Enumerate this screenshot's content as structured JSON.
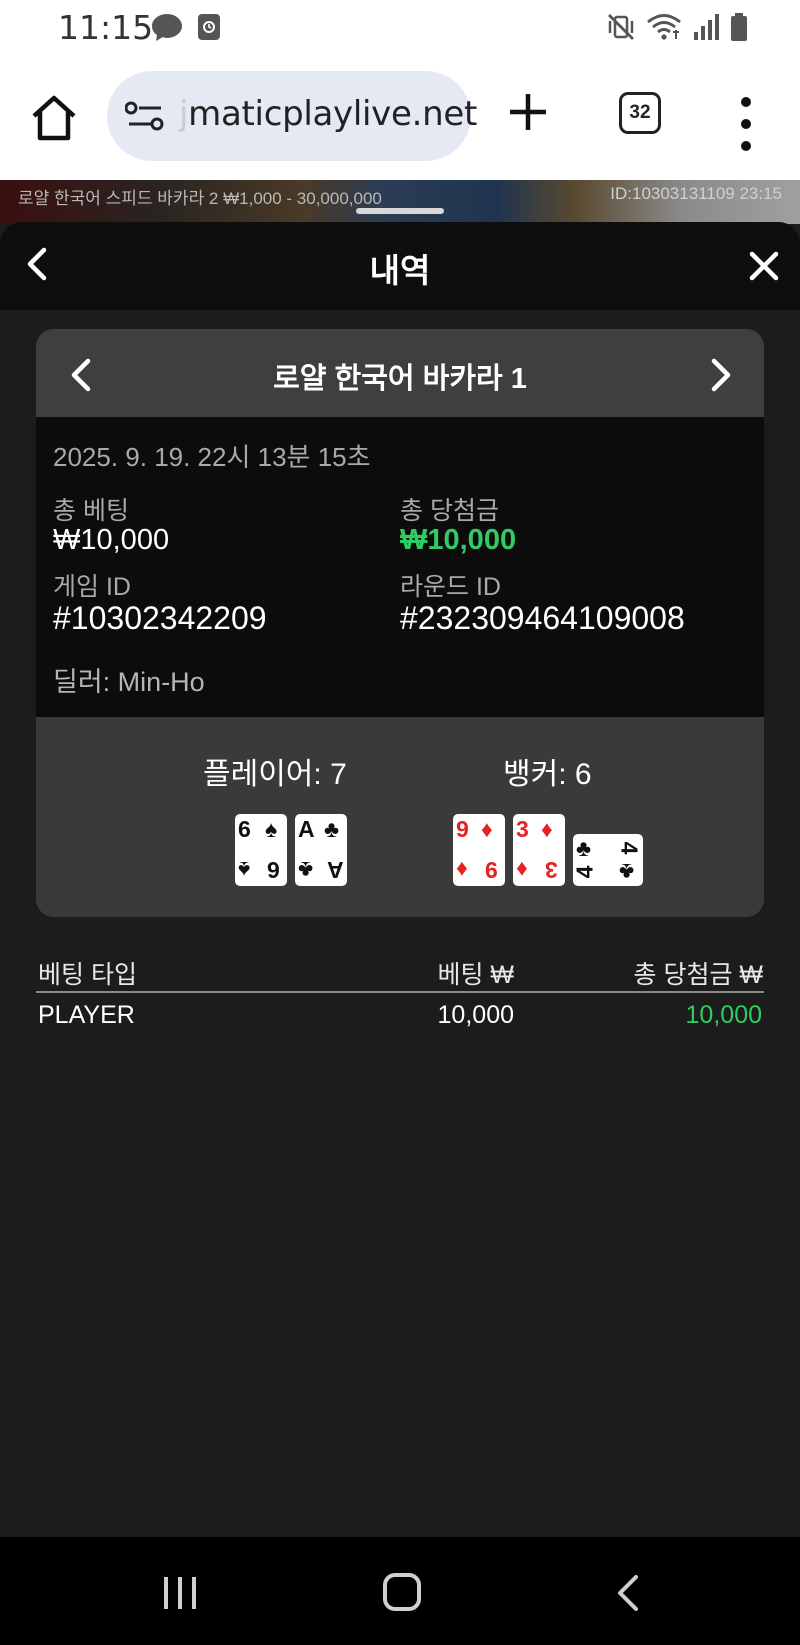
{
  "status_bar": {
    "time": "11:15",
    "icons": [
      "messenger-icon",
      "screen-recorder-icon",
      "vibrate-mute-icon",
      "wifi-icon",
      "signal-icon",
      "battery-icon"
    ]
  },
  "browser": {
    "url_hidden_prefix": "j",
    "url": "maticplaylive.net",
    "tab_count": "32"
  },
  "game_strip": {
    "info": "로얄 한국어 스피드 바카라 2 ₩1,000 - 30,000,000",
    "round_ref": "ID:10303131109 23:15"
  },
  "panel": {
    "title": "내역"
  },
  "round": {
    "game_name": "로얄 한국어 바카라 1",
    "datetime": "2025. 9. 19. 22시 13분 15초",
    "total_bet_label": "총 베팅",
    "total_bet_value": "₩10,000",
    "total_win_label": "총 당첨금",
    "total_win_value": "₩10,000",
    "game_id_label": "게임 ID",
    "game_id_value": "#10302342209",
    "round_id_label": "라운드 ID",
    "round_id_value": "#232309464109008",
    "dealer": "딜러: Min-Ho",
    "player_label": "플레이어: 7",
    "banker_label": "뱅커: 6",
    "player_cards": [
      {
        "rank": "6",
        "suit": "♠",
        "color": "black"
      },
      {
        "rank": "A",
        "suit": "♣",
        "color": "black"
      }
    ],
    "banker_cards": [
      {
        "rank": "9",
        "suit": "♦",
        "color": "red"
      },
      {
        "rank": "3",
        "suit": "♦",
        "color": "red"
      },
      {
        "rank": "4",
        "suit": "♣",
        "color": "black"
      }
    ]
  },
  "bets_table": {
    "headers": {
      "type": "베팅 타입",
      "bet": "베팅 ₩",
      "win": "총 당첨금 ₩"
    },
    "rows": [
      {
        "type": "PLAYER",
        "bet": "10,000",
        "win": "10,000"
      }
    ]
  },
  "colors": {
    "win_green": "#2fcb63",
    "panel_bg": "#1c1c1c",
    "info_bg": "#0c0c0c",
    "card_bg": "#3a3a3a",
    "url_pill": "#e4e9f3"
  }
}
